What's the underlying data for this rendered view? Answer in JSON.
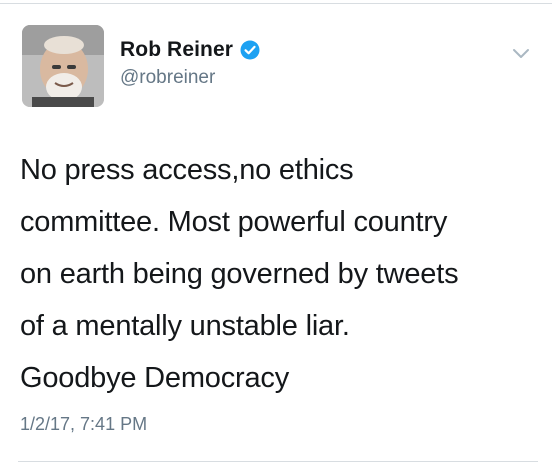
{
  "tweet": {
    "author": {
      "display_name": "Rob Reiner",
      "handle": "@robreiner",
      "verified": true,
      "verified_icon": "verified-badge-icon"
    },
    "menu_icon": "chevron-down-icon",
    "text_lines": [
      "No press access,no ethics",
      "committee. Most powerful country",
      "on earth being governed by tweets",
      "of a mentally unstable liar.",
      "Goodbye Democracy"
    ],
    "timestamp": "1/2/17, 7:41 PM"
  },
  "colors": {
    "text": "#14171a",
    "secondary": "#657786",
    "verified_blue": "#1da1f2",
    "divider": "#d8dde1"
  }
}
